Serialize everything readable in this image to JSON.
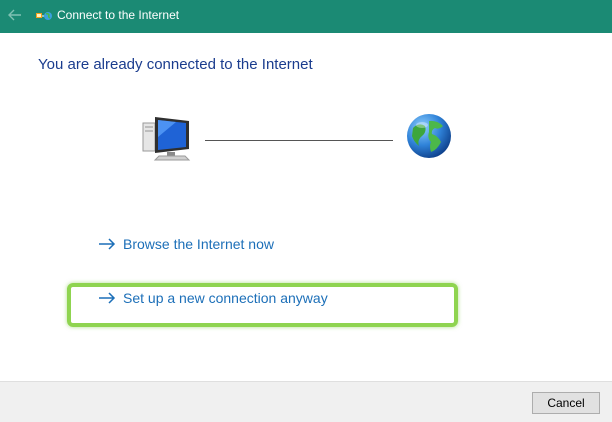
{
  "window": {
    "title": "Connect to the Internet",
    "titlebar_color": "#1b8a74"
  },
  "icons": {
    "back": "back-arrow-icon",
    "app": "network-connection-icon",
    "computer": "computer-monitor-icon",
    "globe": "globe-icon",
    "link_arrow": "right-arrow-icon"
  },
  "main": {
    "heading": "You are already connected to the Internet",
    "tasks": [
      {
        "label": "Browse the Internet now"
      },
      {
        "label": "Set up a new connection anyway"
      }
    ]
  },
  "footer": {
    "cancel_label": "Cancel"
  },
  "colors": {
    "link": "#1c6fb8",
    "heading": "#1a3c8e",
    "highlight": "#8fd450"
  }
}
